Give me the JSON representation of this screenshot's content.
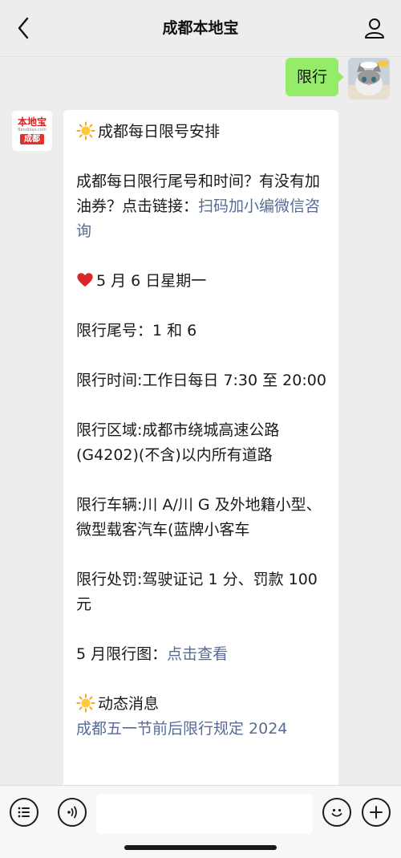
{
  "header": {
    "title": "成都本地宝",
    "back_icon": "chevron-left-icon",
    "profile_icon": "person-icon"
  },
  "outgoing": {
    "text": "限行",
    "bubble_color": "#95ec69"
  },
  "bot_avatar": {
    "logo_text": "本地宝",
    "logo_url": "Bendibao.com",
    "logo_city": "成都"
  },
  "message": {
    "heading": "成都每日限号安排",
    "intro_text": "成都每日限行尾号和时间？有没有加油券？点击链接：",
    "intro_link": "扫码加小编微信咨询",
    "date_line": "5 月 6 日星期一",
    "tail_numbers": "限行尾号：1 和 6",
    "time": "限行时间:工作日每日 7:30 至 20:00",
    "area": "限行区域:成都市绕城高速公路(G4202)(不含)以内所有道路",
    "vehicles": "限行车辆:川 A/川 G 及外地籍小型、微型载客汽车(蓝牌小客车",
    "penalty": "限行处罚:驾驶证记 1 分、罚款 100 元",
    "map_label": "5 月限行图：",
    "map_link": "点击查看",
    "news_heading": "动态消息",
    "news_link": "成都五一节前后限行规定 2024",
    "link_color": "#576b95"
  },
  "bottom": {
    "menu_icon": "list-menu-icon",
    "voice_icon": "voice-icon",
    "emoji_icon": "smiley-icon",
    "plus_icon": "plus-icon",
    "input_placeholder": ""
  }
}
